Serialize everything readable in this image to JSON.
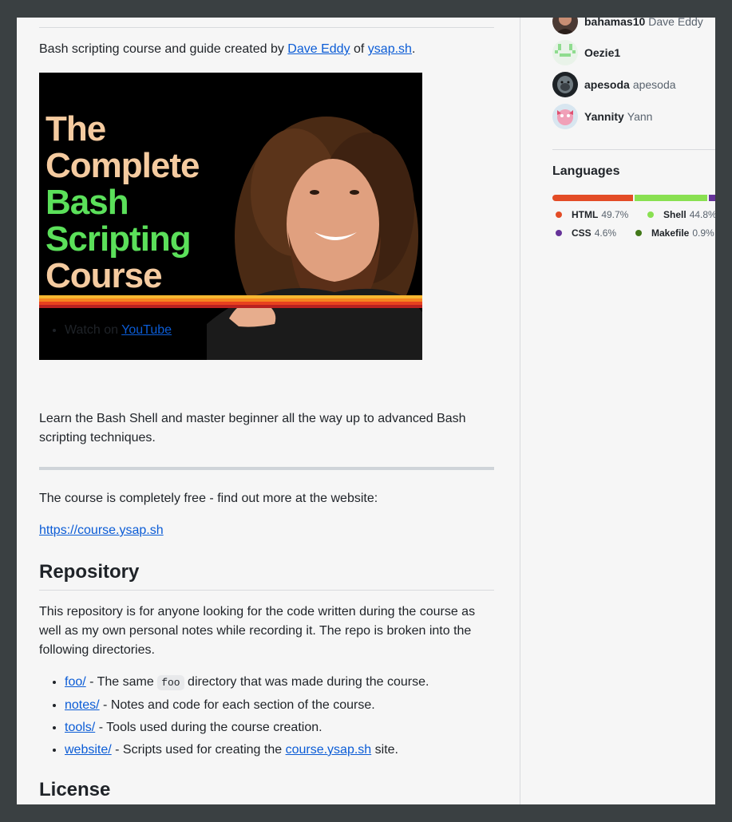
{
  "readme": {
    "intro_prefix": "Bash scripting course and guide created by ",
    "intro_author": "Dave Eddy",
    "intro_mid": " of ",
    "intro_site": "ysap.sh",
    "intro_suffix": ".",
    "thumbnail": {
      "line1": "The",
      "line2": "Complete",
      "line3": "Bash",
      "line4": "Scripting",
      "line5": "Course"
    },
    "watch_prefix": "Watch on ",
    "watch_link": "YouTube",
    "learn_text": "Learn the Bash Shell and master beginner all the way up to advanced Bash scripting techniques.",
    "free_text": "The course is completely free - find out more at the website:",
    "course_url": "https://course.ysap.sh",
    "repo_heading": "Repository",
    "repo_text": "This repository is for anyone looking for the code written during the course as well as my own personal notes while recording it. The repo is broken into the following directories.",
    "dirs": [
      {
        "link": "foo/",
        "pre": " - The same ",
        "code": "foo",
        "post": " directory that was made during the course."
      },
      {
        "link": "notes/",
        "text": " - Notes and code for each section of the course."
      },
      {
        "link": "tools/",
        "text": " - Tools used during the course creation."
      },
      {
        "link": "website/",
        "pre": " - Scripts used for creating the ",
        "site": "course.ysap.sh",
        "post": " site."
      }
    ],
    "license_heading": "License"
  },
  "contributors": [
    {
      "login": "bahamas10",
      "name": "Dave Eddy"
    },
    {
      "login": "Oezie1",
      "name": ""
    },
    {
      "login": "apesoda",
      "name": "apesoda"
    },
    {
      "login": "Yannity",
      "name": "Yann"
    }
  ],
  "languages": {
    "title": "Languages",
    "items": [
      {
        "name": "HTML",
        "percent": "49.7%",
        "value": 49.7,
        "color": "#e34c26"
      },
      {
        "name": "Shell",
        "percent": "44.8%",
        "value": 44.8,
        "color": "#89e051"
      },
      {
        "name": "CSS",
        "percent": "4.6%",
        "value": 4.6,
        "color": "#663399"
      },
      {
        "name": "Makefile",
        "percent": "0.9%",
        "value": 0.9,
        "color": "#427819"
      }
    ]
  }
}
